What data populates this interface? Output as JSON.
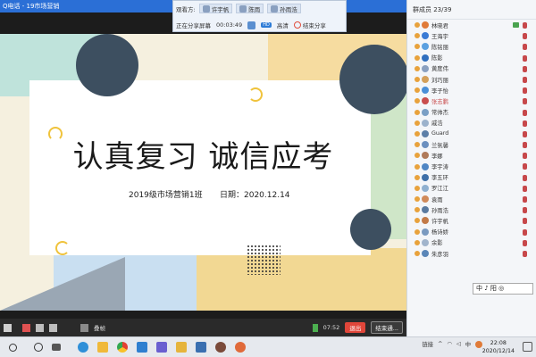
{
  "window": {
    "title": "Q电话 - 19市场营销"
  },
  "share_bar": {
    "viewer_label": "观看方:",
    "viewers": [
      "许宇帆",
      "陈雨",
      "孙雨浩"
    ],
    "status_label": "正在分享屏幕",
    "timer": "00:03:49",
    "quality": "HD",
    "quality_label": "高清",
    "stop_label": "结束分享"
  },
  "slide": {
    "title": "认真复习 诚信应考",
    "class_name": "2019级市场营销1班",
    "date_text": "日期：2020.12.14"
  },
  "control_bar": {
    "page_label": "叠帧",
    "time": "07:52",
    "exit_label": "退出",
    "end_label": "结束通..."
  },
  "member_panel": {
    "header": "群成员 23/39",
    "members": [
      {
        "name": "林晓君",
        "color": "#e07b39"
      },
      {
        "name": "王海宇",
        "color": "#3a7bd5"
      },
      {
        "name": "陈铭丽",
        "color": "#5aa0e0"
      },
      {
        "name": "陈影",
        "color": "#2f6fbf"
      },
      {
        "name": "黄度伟",
        "color": "#8aa0c0"
      },
      {
        "name": "刘巧丽",
        "color": "#d4a05a"
      },
      {
        "name": "李子怡",
        "color": "#4a8fd8"
      },
      {
        "name": "张志鹏",
        "color": "#c94e4e"
      },
      {
        "name": "常帅杰",
        "color": "#7a9fc5"
      },
      {
        "name": "戚浩",
        "color": "#9bb2cc"
      },
      {
        "name": "Guard",
        "color": "#5c7fa8"
      },
      {
        "name": "兰氛馨",
        "color": "#6a8fbf"
      },
      {
        "name": "李娜",
        "color": "#b07a5a"
      },
      {
        "name": "李宇涛",
        "color": "#4f86c4"
      },
      {
        "name": "李五环",
        "color": "#3e6fa8"
      },
      {
        "name": "罗江江",
        "color": "#8fb0d0"
      },
      {
        "name": "袁雨",
        "color": "#d08a5a"
      },
      {
        "name": "孙雨浩",
        "color": "#5a7aa0"
      },
      {
        "name": "许宇帆",
        "color": "#c27a48"
      },
      {
        "name": "杨诗娇",
        "color": "#7a9ac0"
      },
      {
        "name": "余影",
        "color": "#a0b4cc"
      },
      {
        "name": "朱彦羽",
        "color": "#5a86b8"
      }
    ],
    "ime_text": "中 ♪ 阳 ◎"
  },
  "taskbar": {
    "tray_text": "链接",
    "lang": "中",
    "time": "22:08",
    "date": "2020/12/14"
  },
  "colors": {
    "accent_blue": "#2b6fd6",
    "exit_red": "#e0463a",
    "slide_navy": "#3d4f60",
    "slide_teal": "#8fc9c0",
    "slide_yellow": "#f4d08a"
  }
}
